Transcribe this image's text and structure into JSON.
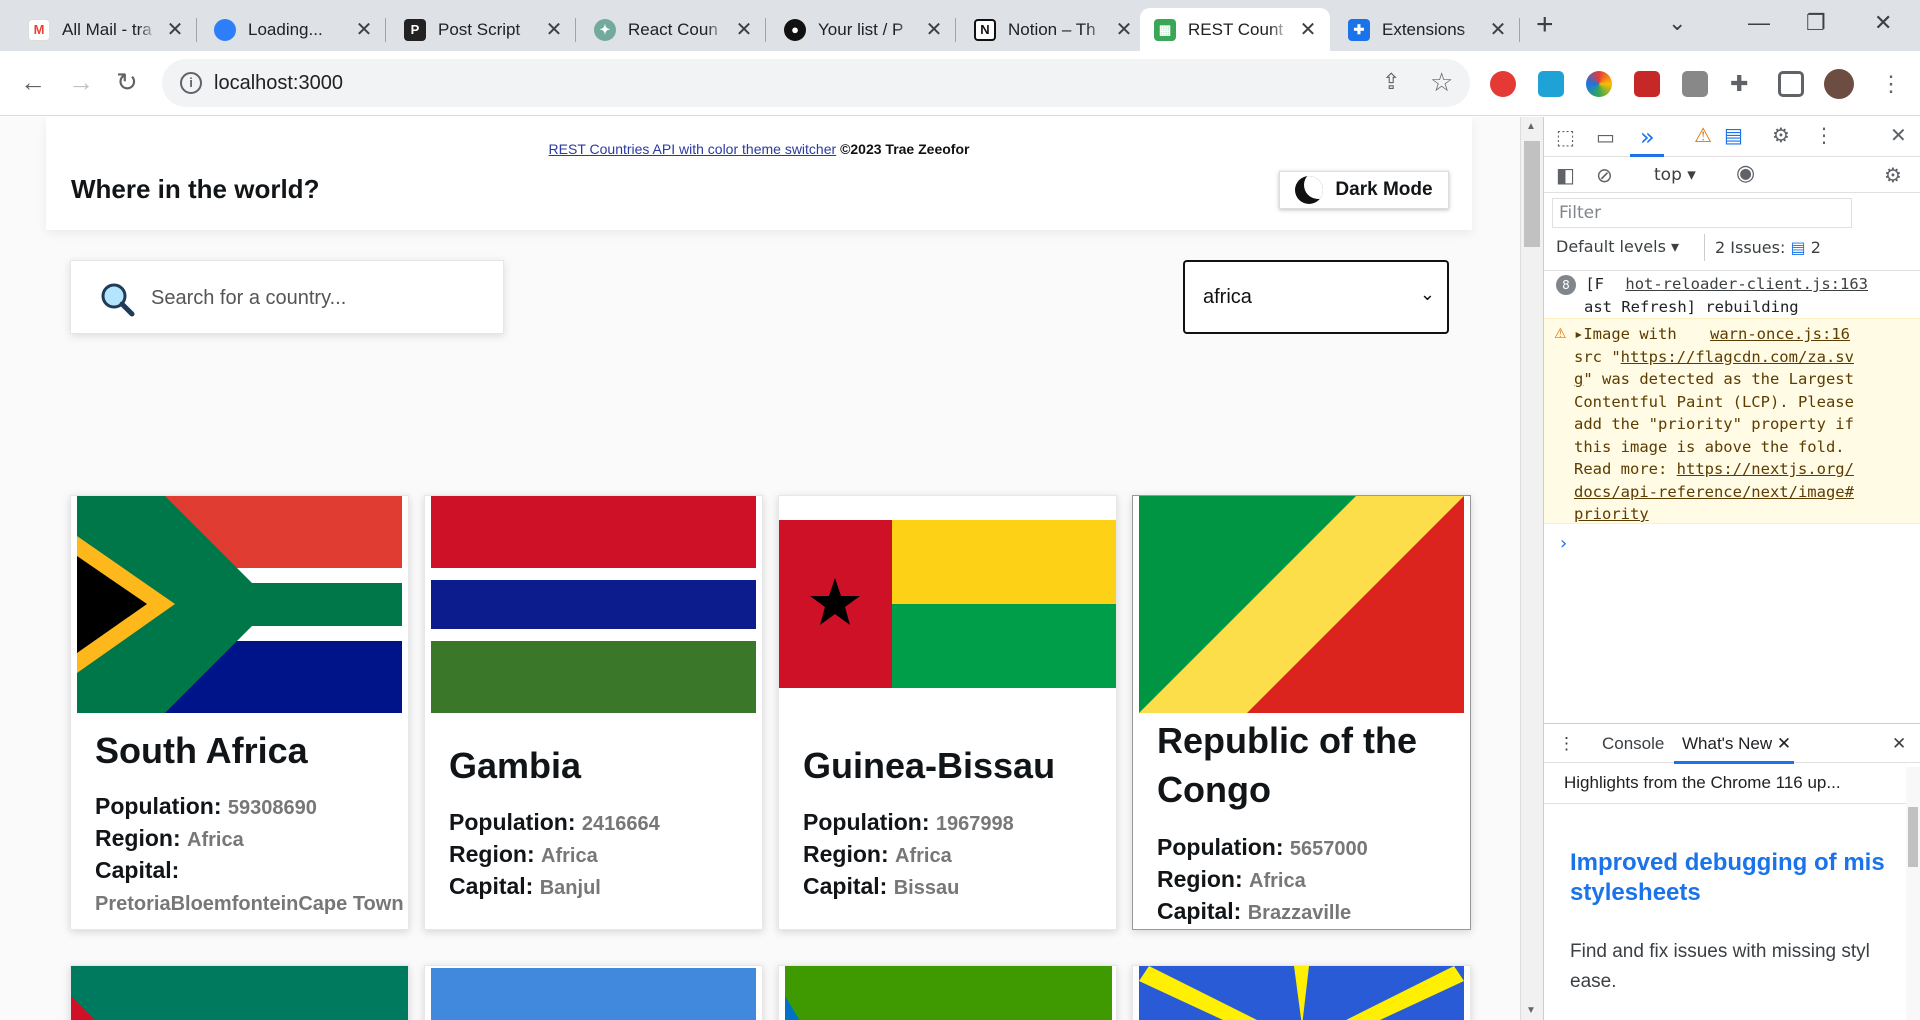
{
  "browser": {
    "tabs": [
      {
        "title": "All Mail - tra",
        "icon": "gmail-icon"
      },
      {
        "title": "Loading...",
        "icon": "cloud-icon"
      },
      {
        "title": "Post Script",
        "icon": "postscript-icon"
      },
      {
        "title": "React Coun",
        "icon": "openai-icon"
      },
      {
        "title": "Your list / P",
        "icon": "github-icon"
      },
      {
        "title": "Notion – Th",
        "icon": "notion-icon"
      },
      {
        "title": "REST Count",
        "icon": "rest-countries-icon"
      },
      {
        "title": "Extensions",
        "icon": "puzzle-icon"
      }
    ],
    "url": "localhost:3000"
  },
  "header": {
    "credit_link": "REST Countries API with color theme switcher",
    "credit_text": "©2023 Trae Zeeofor",
    "title": "Where in the world?",
    "dark_mode_label": "Dark Mode"
  },
  "search": {
    "placeholder": "Search for a country...",
    "value": ""
  },
  "region_filter": {
    "selected": "africa"
  },
  "cards": [
    {
      "name": "South Africa",
      "population_label": "Population:",
      "population": "59308690",
      "region_label": "Region:",
      "region": "Africa",
      "capital_label": "Capital:",
      "capital": "PretoriaBloemfonteinCape Town"
    },
    {
      "name": "Gambia",
      "population_label": "Population:",
      "population": "2416664",
      "region_label": "Region:",
      "region": "Africa",
      "capital_label": "Capital:",
      "capital": "Banjul"
    },
    {
      "name": "Guinea-Bissau",
      "population_label": "Population:",
      "population": "1967998",
      "region_label": "Region:",
      "region": "Africa",
      "capital_label": "Capital:",
      "capital": "Bissau"
    },
    {
      "name": "Republic of the Congo",
      "population_label": "Population:",
      "population": "5657000",
      "region_label": "Region:",
      "region": "Africa",
      "capital_label": "Capital:",
      "capital": "Brazzaville"
    }
  ],
  "devtools": {
    "context": "top",
    "filter_placeholder": "Filter",
    "levels": "Default levels",
    "issues_label": "2 Issues:",
    "issues_count": "2",
    "log1_count": "8",
    "log1_prefix": "[F",
    "log1_source": "hot-reloader-client.js:163",
    "log1_text": "ast Refresh] rebuilding",
    "warn_head": "Image with",
    "warn_source": "warn-once.js:16",
    "warn_src_prefix": "src \"",
    "warn_src_link1": "https://flagcdn.com/za.sv",
    "warn_src_link2": "g",
    "warn_body1": "\" was detected as the Largest",
    "warn_body2": "Contentful Paint (LCP). Please",
    "warn_body3": "add the \"priority\" property if",
    "warn_body4": "this image is above the fold.",
    "warn_readmore": "Read more: ",
    "warn_link_a": "https://nextjs.org/",
    "warn_link_b": "docs/api-reference/next/image#",
    "warn_link_c": "priority",
    "drawer_tab_console": "Console",
    "drawer_tab_whatsnew": "What's New",
    "highlights": "Highlights from the Chrome 116 up...",
    "whatsnew_title_1": "Improved debugging of mis",
    "whatsnew_title_2": "stylesheets",
    "whatsnew_text_1": "Find and fix issues with missing styl",
    "whatsnew_text_2": "ease."
  },
  "colors": {
    "link_blue": "#1a73e8",
    "warn_bg": "#fffbe5",
    "page_bg": "#fafafa"
  }
}
